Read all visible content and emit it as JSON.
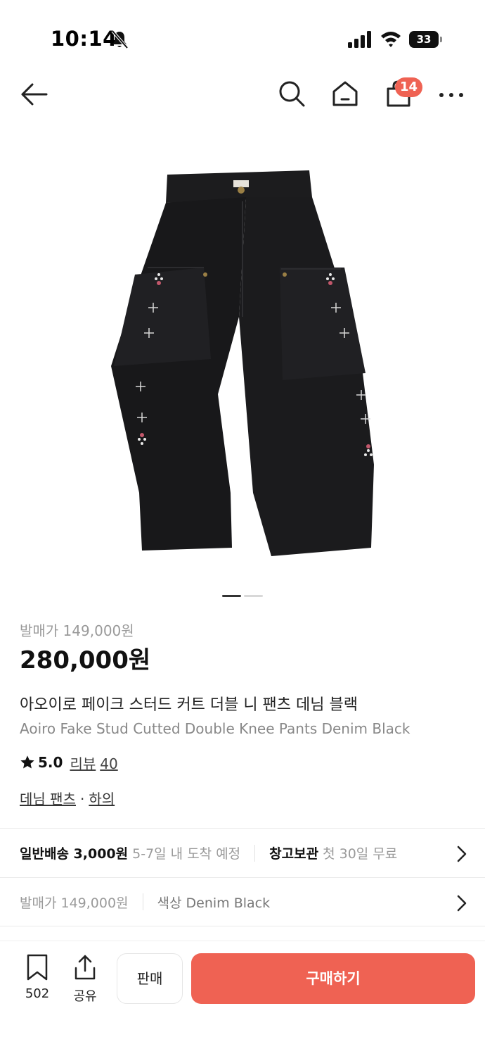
{
  "status_bar": {
    "time": "10:14",
    "battery": "33"
  },
  "nav": {
    "cart_badge": "14",
    "icons": [
      "back-arrow-icon",
      "search-icon",
      "home-icon",
      "shopping-bag-icon",
      "more-icon"
    ]
  },
  "gallery": {
    "page_count": 2,
    "active_index": 0
  },
  "product": {
    "release_price": "발매가 149,000원",
    "price": "280,000원",
    "name_ko": "아오이로 페이크 스터드 커트 더블 니 팬츠 데님 블랙",
    "name_en": "Aoiro Fake Stud Cutted Double Knee Pants Denim Black",
    "rating": "5.0",
    "review_label": "리뷰",
    "review_count": "40",
    "category_1": "데님 팬츠",
    "category_sep": "·",
    "category_2": "하의"
  },
  "shipping_row": {
    "shipping_label": "일반배송 3,000원",
    "shipping_eta": "5-7일 내 도착 예정",
    "storage_label": "창고보관",
    "storage_note": "첫 30일 무료"
  },
  "detail_row": {
    "release": "발매가 149,000원",
    "color": "색상 Denim Black"
  },
  "bottom_bar": {
    "bookmark_count": "502",
    "share_label": "공유",
    "sell_label": "판매",
    "buy_label": "구매하기"
  },
  "colors": {
    "accent": "#ef6253",
    "text": "#222222",
    "muted": "#9a9a9a"
  }
}
